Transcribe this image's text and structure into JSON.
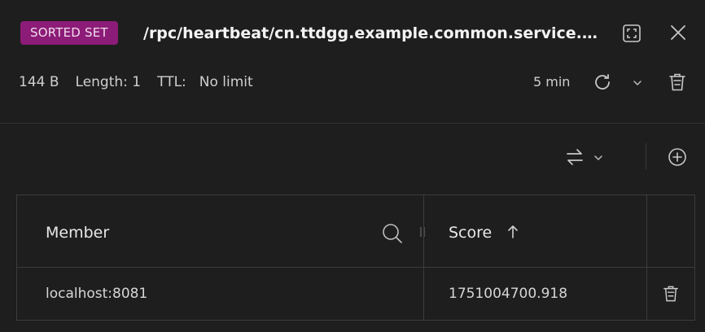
{
  "header": {
    "type_badge": "SORTED SET",
    "key_name": "/rpc/heartbeat/cn.ttdgg.example.common.service.UserService"
  },
  "info": {
    "size": "144 B",
    "length": "Length: 1",
    "ttl_label": "TTL:",
    "ttl_value": "No limit",
    "refresh_interval": "5 min"
  },
  "table": {
    "columns": {
      "member": "Member",
      "score": "Score"
    },
    "rows": [
      {
        "member": "localhost:8081",
        "score": "1751004700.918"
      }
    ]
  },
  "icons": {
    "fullscreen": "fullscreen-icon",
    "close": "close-icon",
    "refresh": "refresh-icon",
    "dropdown": "chevron-down-icon",
    "delete": "trash-icon",
    "format_switch": "swap-arrows-icon",
    "add": "plus-circle-icon",
    "search": "search-icon",
    "sort": "arrow-up-icon",
    "resize": "column-resize-handle"
  },
  "colors": {
    "background": "#1e1e1e",
    "badge_bg": "#8c1c78",
    "border": "#3c3c3c"
  }
}
